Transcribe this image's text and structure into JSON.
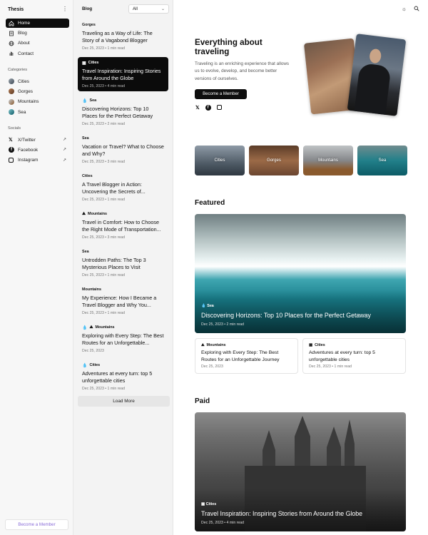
{
  "sidebar": {
    "brand": "Thesis",
    "nav": [
      {
        "label": "Home",
        "icon": "home-icon"
      },
      {
        "label": "Blog",
        "icon": "doc-icon"
      },
      {
        "label": "About",
        "icon": "globe-icon"
      },
      {
        "label": "Contact",
        "icon": "hand-icon"
      }
    ],
    "categories_label": "Categories",
    "categories": [
      "Cities",
      "Gorges",
      "Mountains",
      "Sea"
    ],
    "socials_label": "Socials",
    "socials": [
      "X/Twitter",
      "Facebook",
      "Instagram"
    ],
    "member_button": "Become a Member"
  },
  "blog": {
    "heading": "Blog",
    "filter_value": "All",
    "posts": [
      {
        "category": "Gorges",
        "title": "Traveling as a Way of Life: The Story of a Vagabond Blogger",
        "meta": "Dec 25, 2023  •  1 min read"
      },
      {
        "category": "Cities",
        "title": "Travel Inspiration: Inspiring Stories from Around the Globe",
        "meta": "Dec 25, 2023  •  4 min read"
      },
      {
        "category": "Sea",
        "title": "Discovering Horizons: Top 10 Places for the Perfect Getaway",
        "meta": "Dec 25, 2023  •  2 min read"
      },
      {
        "category": "Sea",
        "title": "Vacation or Travel? What to Choose and Why?",
        "meta": "Dec 25, 2023  •  3 min read"
      },
      {
        "category": "Cities",
        "title": "A Travel Blogger in Action: Uncovering the Secrets of...",
        "meta": "Dec 25, 2023  •  1 min read"
      },
      {
        "category": "Mountains",
        "title": "Travel in Comfort: How to Choose the Right Mode of Transportation...",
        "meta": "Dec 25, 2023  •  3 min read"
      },
      {
        "category": "Sea",
        "title": "Untrodden Paths: The Top 3 Mysterious Places to Visit",
        "meta": "Dec 25, 2023  •  1 min read"
      },
      {
        "category": "Mountains",
        "title": "My Experience: How I Became a Travel Blogger and Why You...",
        "meta": "Dec 25, 2023  •  1 min read"
      },
      {
        "category": "Mountains",
        "title": "Exploring with Every Step: The Best Routes for an Unforgettable...",
        "meta": "Dec 25, 2023"
      },
      {
        "category": "Cities",
        "title": "Adventures at every turn: top 5 unforgettable cities",
        "meta": "Dec 25, 2023  •  1 min read"
      }
    ],
    "load_more": "Load More"
  },
  "hero": {
    "title": "Everything about traveling",
    "description": "Traveling is an enriching experience that allows us to evolve, develop, and become better versions of ourselves.",
    "button": "Become a Member"
  },
  "tiles": [
    "Cities",
    "Gorges",
    "Mountains",
    "Sea"
  ],
  "featured": {
    "heading": "Featured",
    "main": {
      "category": "Sea",
      "title": "Discovering Horizons: Top 10 Places for the Perfect Getaway",
      "meta": "Dec 25, 2023  •  2 min read"
    },
    "sub": [
      {
        "category": "Mountains",
        "title": "Exploring with Every Step: The Best Routes for an Unforgettable Journey",
        "meta": "Dec 25, 2023"
      },
      {
        "category": "Cities",
        "title": "Adventures at every turn: top 5 unforgettable cities",
        "meta": "Dec 25, 2023  •  1 min read"
      }
    ]
  },
  "paid": {
    "heading": "Paid",
    "main": {
      "category": "Cities",
      "title": "Travel Inspiration: Inspiring Stories from Around the Globe",
      "meta": "Dec 25, 2023  •  4 min read"
    }
  },
  "colors": {
    "accent": "#0d0d0d",
    "member_text": "#8a6dd8"
  }
}
